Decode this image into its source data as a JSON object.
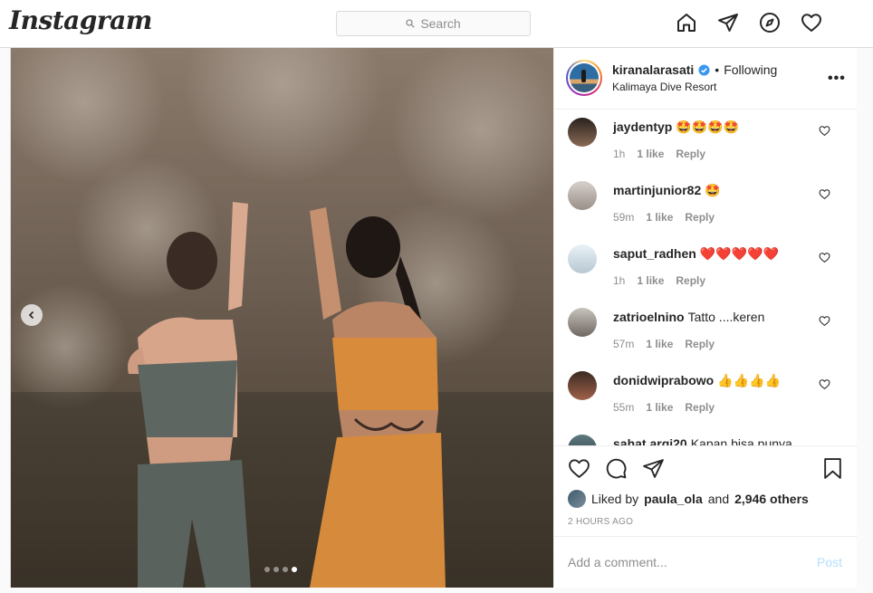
{
  "nav": {
    "logo": "Instagram",
    "search_placeholder": "Search",
    "icons": [
      "home-icon",
      "direct-icon",
      "explore-icon",
      "activity-heart-icon"
    ]
  },
  "post": {
    "author": "kiranalarasati",
    "follow_separator": "•",
    "follow_status": "Following",
    "location": "Kalimaya Dive Resort",
    "more": "•••",
    "carousel": {
      "total": 4,
      "active": 4
    },
    "comments": [
      {
        "user": "jaydentyp",
        "text": "🤩🤩🤩🤩",
        "time": "1h",
        "likes": "1 like",
        "reply": "Reply"
      },
      {
        "user": "martinjunior82",
        "text": "🤩",
        "time": "59m",
        "likes": "1 like",
        "reply": "Reply"
      },
      {
        "user": "saput_radhen",
        "text": "❤️❤️❤️❤️❤️",
        "time": "1h",
        "likes": "1 like",
        "reply": "Reply"
      },
      {
        "user": "zatrioelnino",
        "text": "Tatto ....keren",
        "time": "57m",
        "likes": "1 like",
        "reply": "Reply"
      },
      {
        "user": "donidwiprabowo",
        "text": "👍👍👍👍",
        "time": "55m",
        "likes": "1 like",
        "reply": "Reply"
      },
      {
        "user": "sahat.argi20",
        "text": "Kapan bisa punya",
        "time": "",
        "likes": "",
        "reply": ""
      }
    ],
    "liked_by_prefix": "Liked by",
    "liked_by_user": "paula_ola",
    "liked_by_and": "and",
    "liked_by_others": "2,946 others",
    "posted_time": "2 HOURS AGO",
    "add_comment_placeholder": "Add a comment...",
    "post_button": "Post"
  },
  "colors": {
    "link_blue": "#0095f6",
    "post_disabled": "#b2dffc",
    "verified": "#3897f0",
    "border": "#dbdbdb"
  }
}
